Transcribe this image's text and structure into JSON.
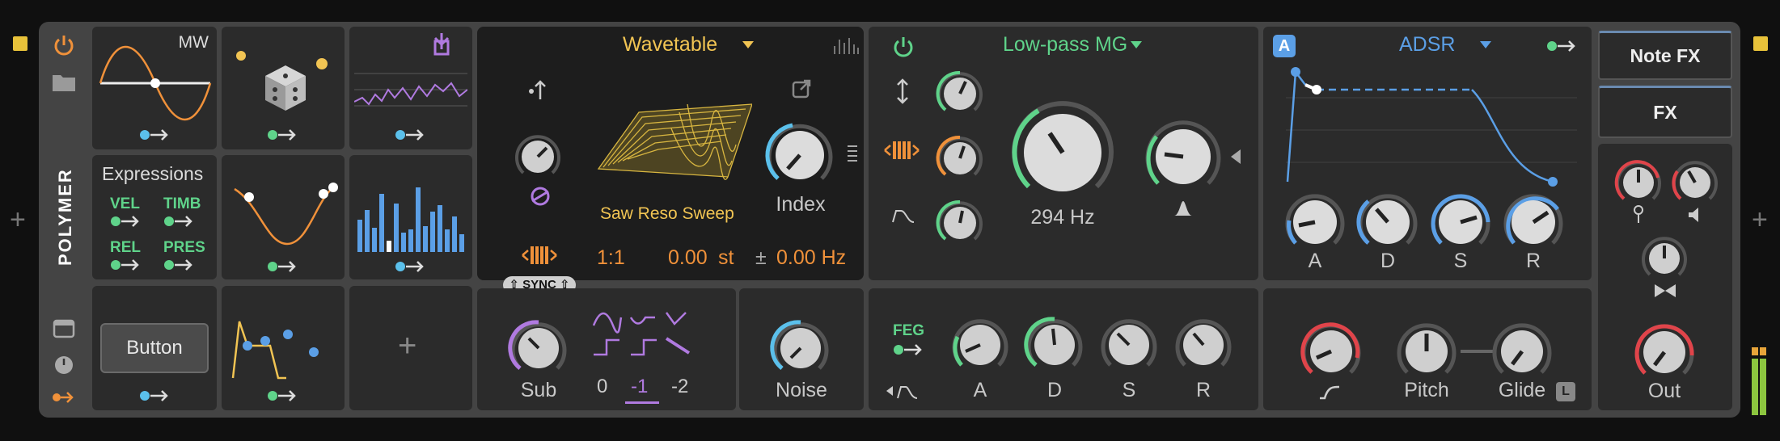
{
  "colors": {
    "accent_yellow": "#f1c453",
    "accent_green": "#5fd38a",
    "accent_blue": "#5b9fe6",
    "accent_orange": "#f0913a",
    "accent_purple": "#b07ae0",
    "accent_red": "#e0444a",
    "panel_bg": "#2b2b2b",
    "device_bg": "#444444"
  },
  "device": {
    "name": "POLYMER"
  },
  "modulators": {
    "lfo_label": "MW",
    "expressions": {
      "title": "Expressions",
      "items": [
        "VEL",
        "TIMB",
        "REL",
        "PRES"
      ]
    },
    "button_label": "Button",
    "add_label": "+"
  },
  "oscillator": {
    "type": "Wavetable",
    "wavetable_name": "Saw Reso Sweep",
    "index_label": "Index",
    "ratio": "1:1",
    "semitones": "0.00",
    "semitone_unit": "st",
    "fine_prefix": "±",
    "fine_hz": "0.00 Hz",
    "sync_label": "SYNC",
    "sub_label": "Sub",
    "octaves": [
      "0",
      "-1",
      "-2"
    ],
    "noise_label": "Noise"
  },
  "filter": {
    "type": "Low-pass MG",
    "cutoff_value": "294 Hz",
    "feg_label": "FEG",
    "env_labels": [
      "A",
      "D",
      "S",
      "R"
    ]
  },
  "amp_env": {
    "badge": "A",
    "type": "ADSR",
    "labels": [
      "A",
      "D",
      "S",
      "R"
    ]
  },
  "output_section": {
    "pitch_label": "Pitch",
    "glide_label": "Glide",
    "glide_badge": "L"
  },
  "fx": {
    "note_fx_label": "Note FX",
    "fx_label": "FX",
    "out_label": "Out"
  }
}
